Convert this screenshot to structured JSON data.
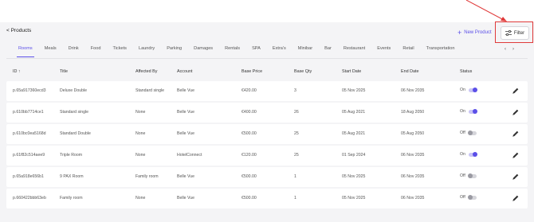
{
  "nav": {
    "back_label": "< Products",
    "new_product_label": "New Product",
    "filter_label": "Filter"
  },
  "tabs": [
    "Rooms",
    "Meals",
    "Drink",
    "Food",
    "Tickets",
    "Laundry",
    "Parking",
    "Damages",
    "Rentals",
    "SPA",
    "Extra's",
    "Minibar",
    "Bar",
    "Restaurant",
    "Events",
    "Retail",
    "Transportation"
  ],
  "active_tab": "Rooms",
  "table": {
    "columns": [
      "ID ↑",
      "Title",
      "Affected By",
      "Account",
      "Base Price",
      "Base Qty",
      "Start Date",
      "End Date",
      "Status"
    ],
    "rows": [
      {
        "id": "p.65a917360ecd3",
        "title": "Deluxe Double",
        "affected_by": "Standard single",
        "account": "Belle Vue",
        "base_price": "€420.00",
        "base_qty": "3",
        "start_date": "05 Nov 2025",
        "end_date": "06 Nov 2035",
        "status": "On",
        "on": true
      },
      {
        "id": "p.610bb7714ce1",
        "title": "Standard single",
        "affected_by": "None",
        "account": "Belle Vue",
        "base_price": "€400.00",
        "base_qty": "26",
        "start_date": "05 Aug 2021",
        "end_date": "18 Aug 2050",
        "status": "On",
        "on": true
      },
      {
        "id": "p.610bc0ea5168d",
        "title": "Standard Double",
        "affected_by": "None",
        "account": "Belle Vue",
        "base_price": "€500.00",
        "base_qty": "25",
        "start_date": "05 Aug 2021",
        "end_date": "05 Aug 2050",
        "status": "Off",
        "on": false
      },
      {
        "id": "p.61f82c514aee9",
        "title": "Triple Room",
        "affected_by": "None",
        "account": "HotelConnect",
        "base_price": "€120.00",
        "base_qty": "25",
        "start_date": "01 Sep 2024",
        "end_date": "06 Nov 2035",
        "status": "On",
        "on": true
      },
      {
        "id": "p.65a918e656b1",
        "title": "9 PAX Room",
        "affected_by": "Family room",
        "account": "Belle Vue",
        "base_price": "€500.00",
        "base_qty": "1",
        "start_date": "05 Nov 2025",
        "end_date": "06 Nov 2035",
        "status": "Off",
        "on": false
      },
      {
        "id": "p.660422bbb63eb",
        "title": "Family room",
        "affected_by": "None",
        "account": "Belle Vue",
        "base_price": "€500.00",
        "base_qty": "1",
        "start_date": "05 Nov 2025",
        "end_date": "06 Nov 2035",
        "status": "Off",
        "on": false
      }
    ]
  },
  "colors": {
    "accent": "#5b4fe8",
    "annotation": "#e03a3a"
  }
}
